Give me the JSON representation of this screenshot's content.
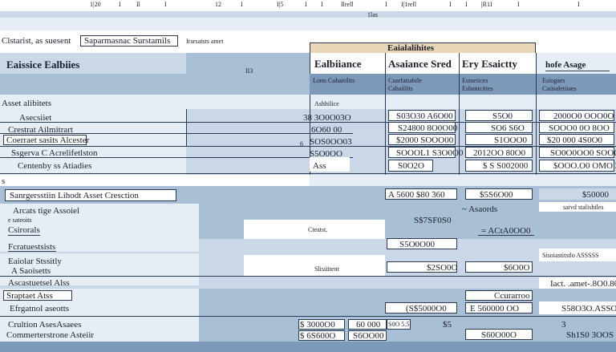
{
  "top_ruler": {
    "labels": [
      "1|20",
      "I",
      "Il",
      "I",
      "12",
      "I",
      "I|5",
      "I",
      "I",
      "Ilrell",
      "I",
      "I|1rell",
      "I",
      "I",
      "|R1I",
      "I",
      "I"
    ],
    "sublabel": "1las"
  },
  "toolbar": {
    "field_label": "Clstarist, as suesent",
    "field_value": "Saparmasnac Surstamils",
    "field_extra": "Irarsatsts amet"
  },
  "header": {
    "title_left": "Eaissice  Ealbiies",
    "tab_top": "Eaialalihites",
    "col_balance": "Ealbiiance",
    "col_stred": "Asaiance Sred",
    "col_esacity": "Ery Esaictty",
    "col_hofe": "hofe Asage",
    "mark": "II3"
  },
  "subheader": {
    "c1": "Lonn Cuhaitilits",
    "c2a": "Cuarfatiabile",
    "c2b": "Cahaiilits",
    "c3a": "Esmeiices",
    "c3b": "Eshanicities",
    "c4a": "Esiogaes",
    "c4b": "Caiisaletiiaes"
  },
  "section1": {
    "title": "Asset alibitets",
    "subtitle": "Ashhilice",
    "rows": [
      {
        "label": "Asecsiiet",
        "v1": "38 3O0O03O",
        "v2": "S03O30  A6O00",
        "v3": "S5O0",
        "v4": "2000O0 OOO0O"
      },
      {
        "label": "Crestrat Ailmitrart",
        "v1": "6O60 00",
        "v2": "S24800 8O0O00",
        "v3": "SO6 S6O",
        "v4": "SOOO0 0O 8OO"
      },
      {
        "label": "Coerraet  sasits Alcester",
        "v1": "SOS0OO03",
        "v2": "$2000 SOOO00",
        "v3": "S1OOO0",
        "v4": "$20 000 4S0O0"
      },
      {
        "label": "Ssgerva  C Acrelifetlston",
        "v1": "S5O0OO",
        "v2": "SOOOL1 S3O0O0",
        "v3": "2012OO 80O0",
        "v4": "SO0O0OO0 SOOO"
      },
      {
        "label": "Centenby ss  Atiadies",
        "v1": "Ass",
        "v2": "S0O2O",
        "v3": "$  S S002000",
        "v4": "$OOO.O0  OMO 3O"
      }
    ],
    "row_mark": "6"
  },
  "section2": {
    "title": "Sanrgersstiin  Lihodt  Asset  Cresction",
    "summary_v2": "A  5600 $80 360",
    "summary_v3": "$5S6O00",
    "summary_v4": "$50000",
    "note1": "Arcats  tige  Assoiel",
    "note2": "e  sateoits",
    "note3": "Csirorals",
    "sub_v3": "~ Asaords",
    "sub_v4": "saivd stalishiles",
    "val_a": "S$7SF0S0",
    "val_b": "=  ACtA0OO0",
    "center_label": "Cteatst."
  },
  "section3": {
    "title": "Fcratuestsists",
    "v2": "S5O0O00",
    "rows": [
      {
        "label": "Eaiolar Stssitly",
        "sub": "A   Saoisetts",
        "v1": "Slisiiitent",
        "v2": "$2SO0O",
        "v3": "$6O0O",
        "v4": "Sisoiastitstlo ASSSSS"
      },
      {
        "label": "Ascastuetsel Alss",
        "v4": "Iact. .amet-.8O0.80"
      }
    ]
  },
  "section4": {
    "rows": [
      {
        "label": "Sraptaet  Atss",
        "v3": "Ccurarroo"
      },
      {
        "label": "Efrgatnol   aseotts",
        "v2": "(S$5000O0",
        "v3": "E   560000 OO",
        "v4": "S58O3O.ASSO0"
      },
      {
        "label": "Crultion  AsesAsaees",
        "v1": "$ 3000O0",
        "v1b": "60 000",
        "v2": "S0O 5.5",
        "v3": "$5",
        "v4": "3"
      },
      {
        "label": "Commerterstrone  Asteiir",
        "v1": "$ 6S600O",
        "v1b": "S6OO00",
        "v2": "",
        "v3": "S60O00O",
        "v4": "Sh1S0 3OOS"
      }
    ]
  }
}
